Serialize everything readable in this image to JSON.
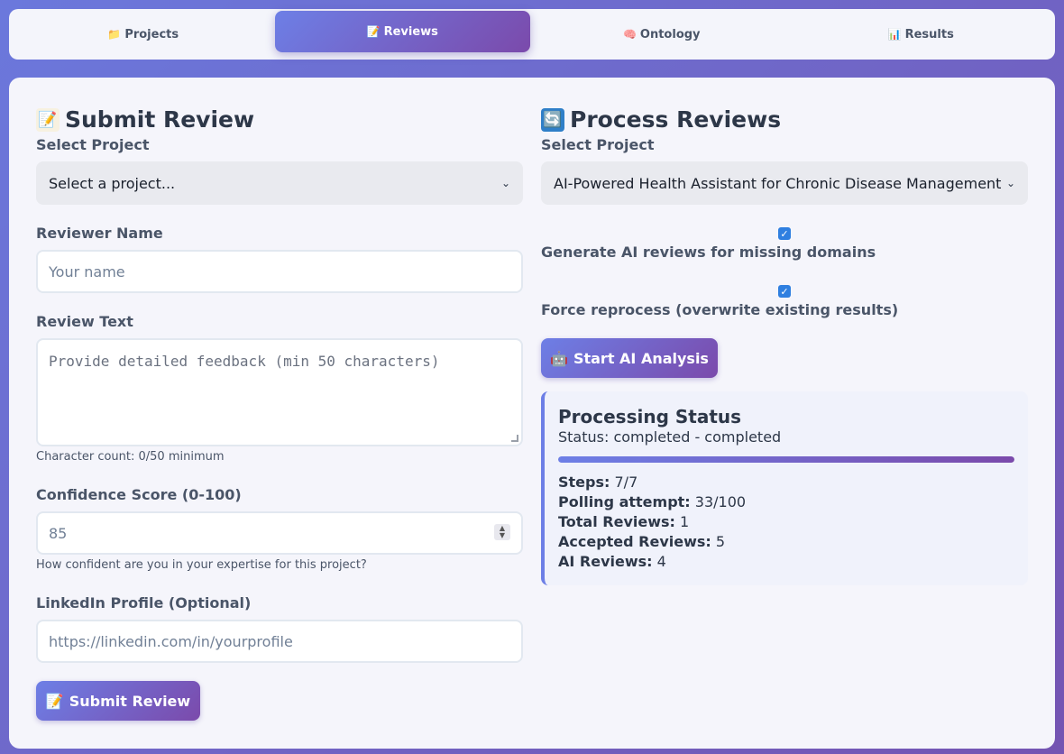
{
  "tabs": [
    {
      "icon": "📁",
      "label": "Projects",
      "active": false
    },
    {
      "icon": "📝",
      "label": "Reviews",
      "active": true
    },
    {
      "icon": "🧠",
      "label": "Ontology",
      "active": false
    },
    {
      "icon": "📊",
      "label": "Results",
      "active": false
    }
  ],
  "submit": {
    "title_icon": "📝",
    "title": "Submit Review",
    "project_label": "Select Project",
    "project_value": "Select a project...",
    "name_label": "Reviewer Name",
    "name_placeholder": "Your name",
    "text_label": "Review Text",
    "text_placeholder": "Provide detailed feedback (min 50 characters)",
    "char_count": "Character count: 0/50 minimum",
    "confidence_label": "Confidence Score (0-100)",
    "confidence_value": "85",
    "confidence_hint": "How confident are you in your expertise for this project?",
    "linkedin_label": "LinkedIn Profile (Optional)",
    "linkedin_placeholder": "https://linkedin.com/in/yourprofile",
    "button_icon": "📝",
    "button_label": "Submit Review"
  },
  "process": {
    "title_icon": "🔄",
    "title": "Process Reviews",
    "project_label": "Select Project",
    "project_value": "AI-Powered Health Assistant for Chronic Disease Management",
    "generate_label": "Generate AI reviews for missing domains",
    "generate_checked": true,
    "force_label": "Force reprocess (overwrite existing results)",
    "force_checked": true,
    "button_icon": "🤖",
    "button_label": "Start AI Analysis",
    "status": {
      "title": "Processing Status",
      "line": "Status: completed - completed",
      "progress": 1.0,
      "steps_label": "Steps:",
      "steps_value": "7/7",
      "polling_label": "Polling attempt:",
      "polling_value": "33/100",
      "total_label": "Total Reviews:",
      "total_value": "1",
      "accepted_label": "Accepted Reviews:",
      "accepted_value": "5",
      "ai_label": "AI Reviews:",
      "ai_value": "4"
    }
  },
  "colors": {
    "accent_start": "#6d7fe6",
    "accent_end": "#7b4aab",
    "checkbox": "#2f7fe0"
  }
}
